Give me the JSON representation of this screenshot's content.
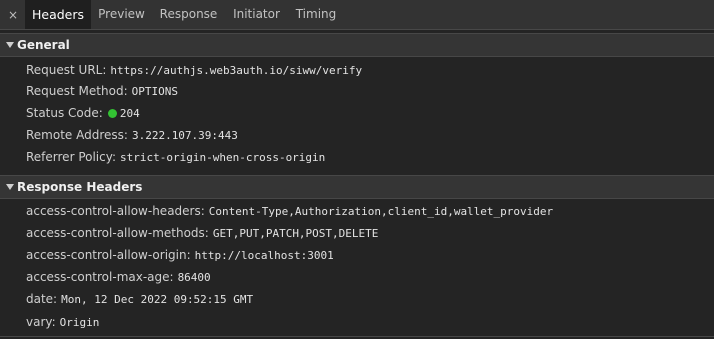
{
  "tabs": {
    "close_icon": "×",
    "items": [
      {
        "label": "Headers",
        "active": true
      },
      {
        "label": "Preview"
      },
      {
        "label": "Response"
      },
      {
        "label": "Initiator"
      },
      {
        "label": "Timing"
      }
    ]
  },
  "general": {
    "title": "General",
    "request_url": {
      "key": "Request URL:",
      "value": "https://authjs.web3auth.io/siww/verify"
    },
    "request_method": {
      "key": "Request Method:",
      "value": "OPTIONS"
    },
    "status_code": {
      "key": "Status Code:",
      "value": "204",
      "status_color": "#33c233"
    },
    "remote_address": {
      "key": "Remote Address:",
      "value": "3.222.107.39:443"
    },
    "referrer_policy": {
      "key": "Referrer Policy:",
      "value": "strict-origin-when-cross-origin"
    }
  },
  "response_headers": {
    "title": "Response Headers",
    "items": [
      {
        "key": "access-control-allow-headers:",
        "value": "Content-Type,Authorization,client_id,wallet_provider"
      },
      {
        "key": "access-control-allow-methods:",
        "value": "GET,PUT,PATCH,POST,DELETE"
      },
      {
        "key": "access-control-allow-origin:",
        "value": "http://localhost:3001"
      },
      {
        "key": "access-control-max-age:",
        "value": "86400"
      },
      {
        "key": "date:",
        "value": "Mon, 12 Dec 2022 09:52:15 GMT"
      },
      {
        "key": "vary:",
        "value": "Origin"
      }
    ]
  }
}
